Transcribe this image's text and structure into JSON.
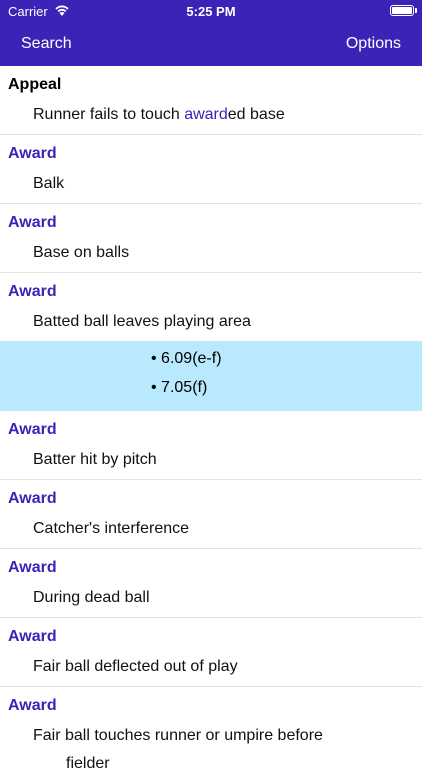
{
  "status": {
    "carrier": "Carrier",
    "time": "5:25 PM"
  },
  "nav": {
    "left": "Search",
    "right": "Options"
  },
  "first": {
    "title": "Appeal",
    "sub_before": "Runner fails to touch ",
    "sub_highlight": "award",
    "sub_after": "ed base"
  },
  "entries": [
    {
      "title": "Award",
      "sub": "Balk"
    },
    {
      "title": "Award",
      "sub": "Base on balls"
    },
    {
      "title": "Award",
      "sub": "Batted ball leaves playing area"
    },
    {
      "title": "Award",
      "sub": "Batter hit by pitch"
    },
    {
      "title": "Award",
      "sub": "Catcher's interference"
    },
    {
      "title": "Award",
      "sub": "During dead ball"
    },
    {
      "title": "Award",
      "sub": "Fair ball deflected out of play"
    },
    {
      "title": "Award",
      "sub": "Fair ball touches runner or umpire before",
      "sub_cont": "fielder"
    }
  ],
  "refs": [
    "• 6.09(e-f)",
    "• 7.05(f)"
  ],
  "colors": {
    "accent": "#3a24b8",
    "highlight_bg": "#b8e9ff"
  }
}
